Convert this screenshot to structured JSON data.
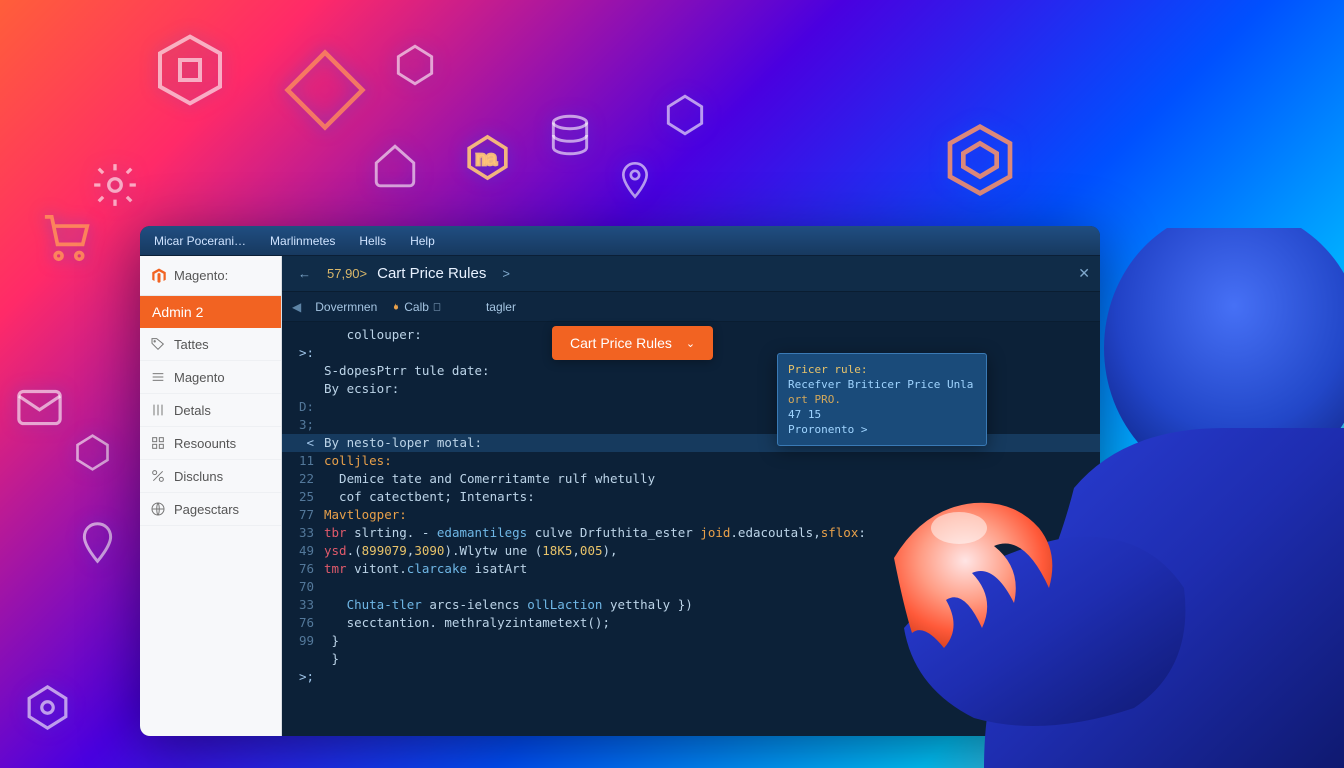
{
  "menubar": {
    "items": [
      "Micar Pocerani…",
      "Marlinmetes",
      "Hells",
      "Help"
    ]
  },
  "sidebar": {
    "brand": "Magento:",
    "header": "Admin 2",
    "items": [
      {
        "icon": "tag",
        "label": "Tattes"
      },
      {
        "icon": "list",
        "label": "Magento"
      },
      {
        "icon": "sliders",
        "label": "Detals"
      },
      {
        "icon": "grid",
        "label": "Resoounts"
      },
      {
        "icon": "percent",
        "label": "Discluns"
      },
      {
        "icon": "globe",
        "label": "Pagesctars"
      }
    ]
  },
  "breadcrumb": {
    "back": "←",
    "num": "57,90>",
    "title": "Cart Price Rules",
    "forward": ">",
    "close": "✕"
  },
  "tabs": {
    "arrow": "◀",
    "items": [
      "Dovermnen",
      "Calb",
      "tagler"
    ]
  },
  "dropdown": {
    "label": "Cart Price Rules"
  },
  "tooltip": {
    "lines": [
      "Pricer rule:",
      "Recefver Briticer Price Unla",
      "ort PRO.",
      "47  15",
      "Proronento >"
    ]
  },
  "code": [
    {
      "g": "",
      "t": "   collouper:"
    },
    {
      "g": ">:",
      "t": ""
    },
    {
      "g": "",
      "t": "S-dopesPtrr tule date:"
    },
    {
      "g": "",
      "t": "By ecsior:"
    },
    {
      "g": "D:",
      "t": ""
    },
    {
      "g": "3;",
      "t": ""
    },
    {
      "g": "<",
      "hl": true,
      "t": "By nesto-loper motal:"
    },
    {
      "g": "11",
      "t": "colljles:",
      "cls": "kw"
    },
    {
      "g": "22",
      "t": "  Demice tate and Comerritamte rulf whetully"
    },
    {
      "g": "25",
      "t": "  cof catectbent; Intenarts:"
    },
    {
      "g": "77",
      "t": "Mavtlogper:",
      "cls": "kw"
    },
    {
      "g": "33",
      "t": "tbr slrting. - edamantilegs culve Drfuthita_ester joid.edacoutals,sflox:",
      "mix": true
    },
    {
      "g": "49",
      "t": "ysd.(899079,3090).Wlytw une (18K5,005),",
      "mix2": true
    },
    {
      "g": "76",
      "t": "tmr vitont.clarcake isatArt",
      "mix3": true
    },
    {
      "g": "70",
      "t": ""
    },
    {
      "g": "33",
      "t": "   Chuta-tler arcs-ielencs ollLaction yetthaly })",
      "fn": true
    },
    {
      "g": "76",
      "t": "   secctantion. methralyzintametext();"
    },
    {
      "g": "99",
      "t": " }"
    },
    {
      "g": "",
      "t": " }"
    },
    {
      "g": ">;",
      "t": ""
    }
  ]
}
